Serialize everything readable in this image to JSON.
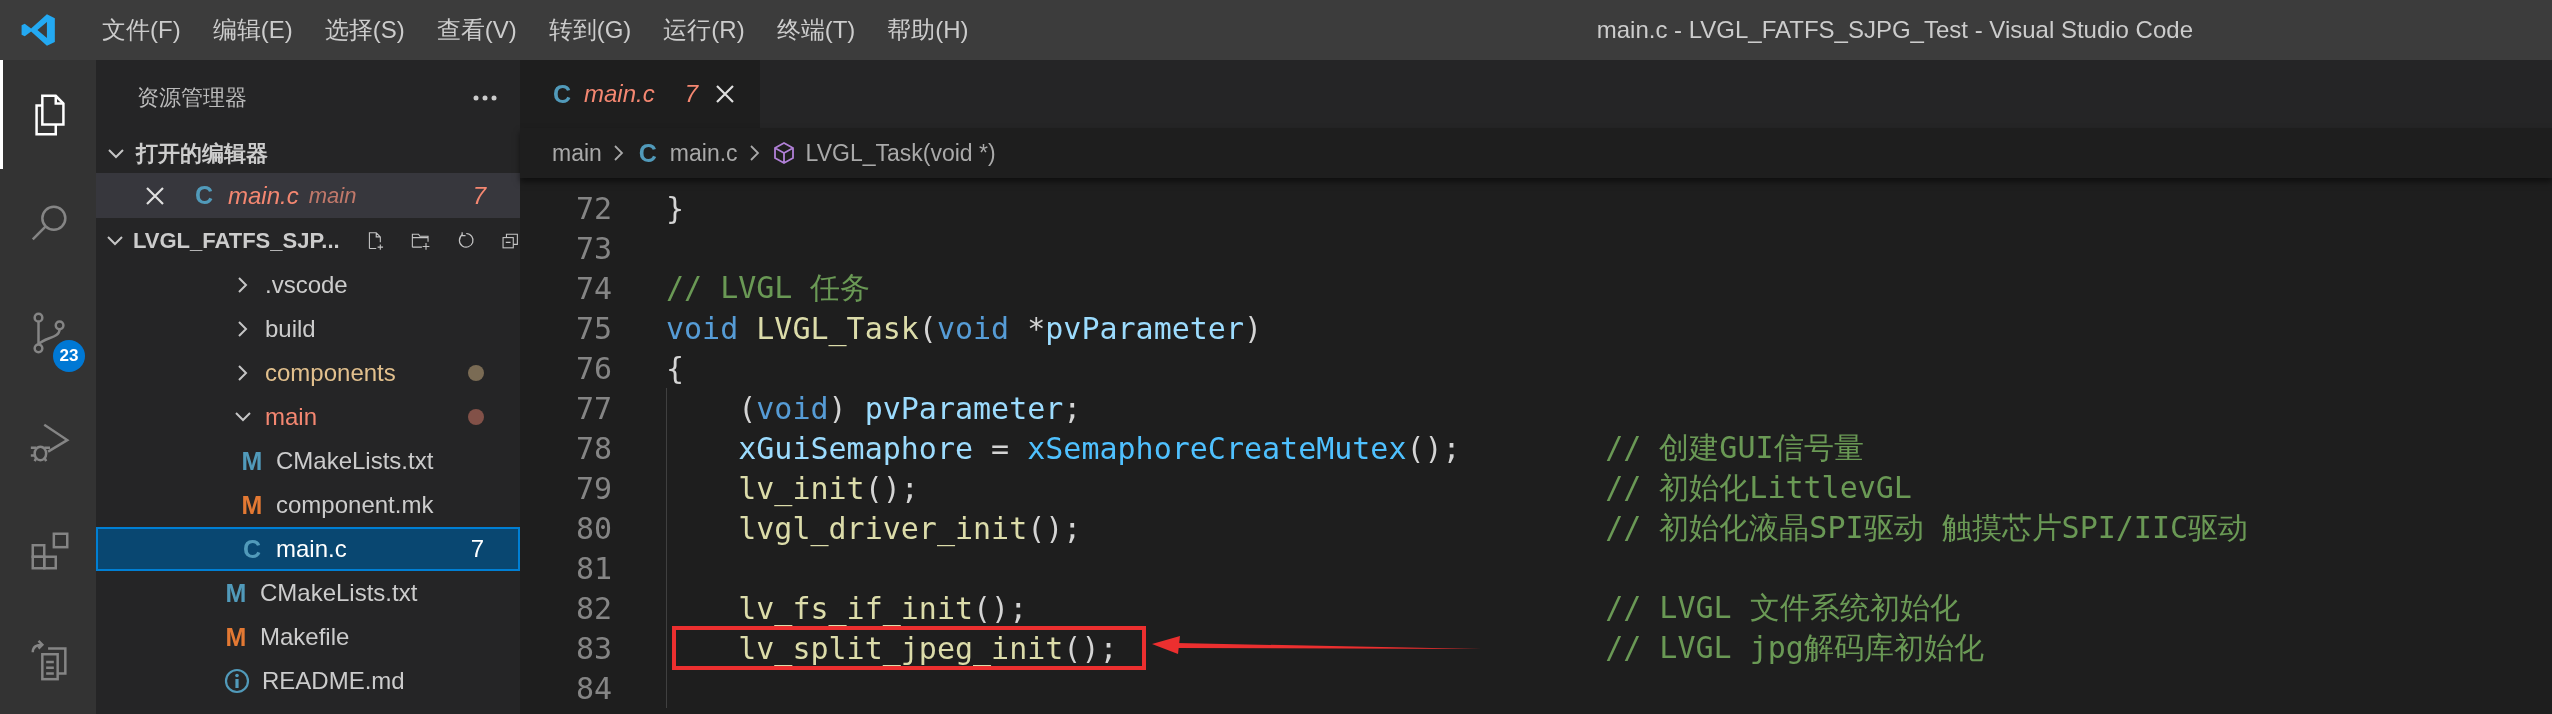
{
  "window": {
    "title": "main.c - LVGL_FATFS_SJPG_Test - Visual Studio Code"
  },
  "menu": [
    "文件(F)",
    "编辑(E)",
    "选择(S)",
    "查看(V)",
    "转到(G)",
    "运行(R)",
    "终端(T)",
    "帮助(H)"
  ],
  "activity_bar": [
    {
      "kind": "explorer",
      "selected": true
    },
    {
      "kind": "search",
      "selected": false
    },
    {
      "kind": "source-control",
      "selected": false,
      "badge": "23"
    },
    {
      "kind": "run-debug",
      "selected": false
    },
    {
      "kind": "extensions",
      "selected": false
    },
    {
      "kind": "documents",
      "selected": false
    }
  ],
  "sidebar": {
    "title": "资源管理器",
    "open_editors": {
      "title": "打开的编辑器",
      "expanded": true,
      "items": [
        {
          "name": "main.c",
          "folder": "main",
          "icon": "C",
          "kind": "c",
          "problems": "7",
          "selected": false
        }
      ]
    },
    "project": {
      "title": "LVGL_FATFS_SJP...",
      "expanded": true,
      "tree": [
        {
          "name": ".vscode",
          "kind": "folder",
          "expanded": false,
          "selected": false
        },
        {
          "name": "build",
          "kind": "folder",
          "expanded": false,
          "selected": false
        },
        {
          "name": "components",
          "kind": "folder",
          "expanded": false,
          "color": "#e2c08d",
          "selected": false
        },
        {
          "name": "main",
          "kind": "folder",
          "expanded": true,
          "color": "#f48771",
          "selected": false,
          "children": [
            {
              "name": "CMakeLists.txt",
              "kind": "cmake",
              "icon": "M",
              "selected": false
            },
            {
              "name": "component.mk",
              "kind": "make",
              "icon": "M",
              "selected": false
            },
            {
              "name": "main.c",
              "kind": "c",
              "icon": "C",
              "selected": true,
              "problems": "7"
            }
          ]
        },
        {
          "name": "CMakeLists.txt",
          "kind": "cmake",
          "icon": "M",
          "selected": false
        },
        {
          "name": "Makefile",
          "kind": "make",
          "icon": "M",
          "selected": false
        },
        {
          "name": "README.md",
          "kind": "info",
          "selected": false
        }
      ]
    }
  },
  "editor": {
    "tabs": [
      {
        "label": "main.c",
        "icon": "C",
        "kind": "c",
        "problems": "7",
        "selected": true
      }
    ],
    "breadcrumb": [
      {
        "label": "main",
        "kind": "folder"
      },
      {
        "label": "main.c",
        "kind": "c",
        "icon": "C"
      },
      {
        "label": "LVGL_Task(void *)",
        "kind": "symbol"
      }
    ],
    "lines": [
      {
        "number": "72",
        "tokens": [
          {
            "kind": "punct",
            "text": "}"
          }
        ]
      },
      {
        "number": "73"
      },
      {
        "number": "74",
        "tokens": [
          {
            "kind": "comment",
            "text": "// LVGL 任务"
          }
        ]
      },
      {
        "number": "75",
        "tokens": [
          {
            "kind": "keyword",
            "text": "void"
          },
          {
            "kind": "function",
            "text": "LVGL_Task",
            "space_before": true
          },
          {
            "kind": "punct",
            "text": "("
          },
          {
            "kind": "keyword",
            "text": "void"
          },
          {
            "kind": "punct",
            "text": "*",
            "space_before": true
          },
          {
            "kind": "variable",
            "text": "pvParameter"
          },
          {
            "kind": "punct",
            "text": ")"
          }
        ]
      },
      {
        "number": "76",
        "tokens": [
          {
            "kind": "punct",
            "text": "{"
          }
        ]
      },
      {
        "number": "77",
        "indented": true,
        "tokens": [
          {
            "kind": "punct",
            "text": "("
          },
          {
            "kind": "keyword",
            "text": "void"
          },
          {
            "kind": "punct",
            "text": ")"
          },
          {
            "kind": "variable",
            "text": "pvParameter",
            "space_before": true
          },
          {
            "kind": "punct",
            "text": ";"
          }
        ]
      },
      {
        "number": "78",
        "indented": true,
        "tokens": [
          {
            "kind": "variable",
            "text": "xGuiSemaphore"
          },
          {
            "kind": "punct",
            "text": "=",
            "space_before": true
          },
          {
            "kind": "macro",
            "text": "xSemaphoreCreateMutex",
            "space_before": true
          },
          {
            "kind": "punct",
            "text": "();"
          }
        ],
        "comment": "// 创建GUI信号量"
      },
      {
        "number": "79",
        "indented": true,
        "tokens": [
          {
            "kind": "function",
            "text": "lv_init"
          },
          {
            "kind": "punct",
            "text": "();"
          }
        ],
        "comment": "// 初始化LittlevGL"
      },
      {
        "number": "80",
        "indented": true,
        "tokens": [
          {
            "kind": "function",
            "text": "lvgl_driver_init"
          },
          {
            "kind": "punct",
            "text": "();"
          }
        ],
        "comment": "// 初始化液晶SPI驱动 触摸芯片SPI/IIC驱动"
      },
      {
        "number": "81",
        "indented": true
      },
      {
        "number": "82",
        "indented": true,
        "tokens": [
          {
            "kind": "function",
            "text": "lv_fs_if_init"
          },
          {
            "kind": "punct",
            "text": "();"
          }
        ],
        "comment": "// LVGL 文件系统初始化"
      },
      {
        "number": "83",
        "indented": true,
        "highlighted": true,
        "tokens": [
          {
            "kind": "function",
            "text": "lv_split_jpeg_init"
          },
          {
            "kind": "punct",
            "text": "();"
          }
        ],
        "comment": "// LVGL jpg解码库初始化"
      },
      {
        "number": "84",
        "indented": true
      }
    ]
  }
}
